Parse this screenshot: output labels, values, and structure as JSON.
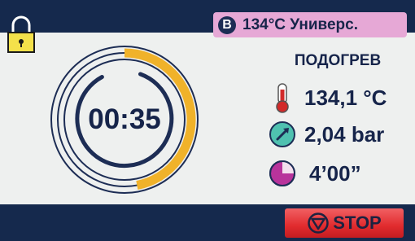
{
  "header": {
    "program_letter": "B",
    "program_name": "134°C Универс."
  },
  "status": {
    "phase": "ПОДОГРЕВ"
  },
  "timer": {
    "display": "00:35",
    "progress_fraction": 0.47
  },
  "readings": {
    "temperature": "134,1 °C",
    "pressure": "2,04 bar",
    "duration": "4’00”"
  },
  "controls": {
    "stop_label": "STOP"
  },
  "colors": {
    "background": "#eef0ef",
    "bars": "#15294d",
    "progress_arc": "#f0b22a",
    "program_badge": "#e6a8d6",
    "stop_button": "#e12b2e",
    "temperature_icon": "#d22a2a",
    "pressure_icon": "#4fc1b0",
    "duration_icon": "#b8339b"
  },
  "icons": {
    "lock": "lock-icon",
    "temperature": "thermometer-icon",
    "pressure": "gauge-icon",
    "duration": "clock-icon",
    "stop": "stop-icon"
  }
}
